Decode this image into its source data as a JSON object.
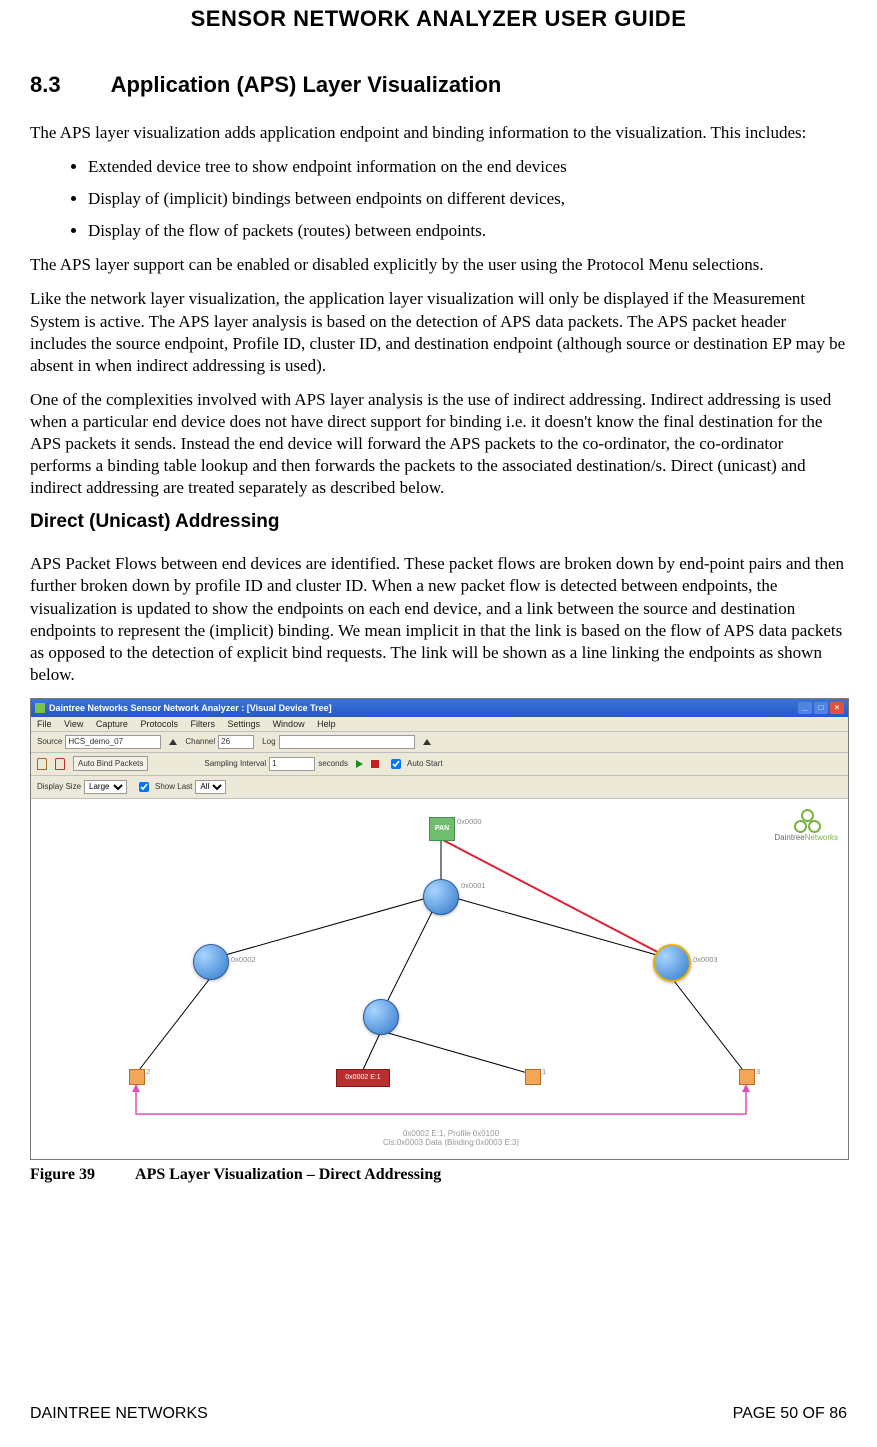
{
  "header": {
    "title": "SENSOR NETWORK ANALYZER USER GUIDE"
  },
  "section": {
    "number": "8.3",
    "title": "Application (APS) Layer Visualization"
  },
  "intro_paragraph": "The APS layer visualization adds application endpoint and binding information to the visualization. This includes:",
  "bullets": {
    "b1": "Extended device tree to show endpoint information on the end devices",
    "b2": "Display of (implicit) bindings between endpoints on different devices,",
    "b3": "Display of the flow of packets (routes) between endpoints."
  },
  "para2": "The APS layer support can be enabled or disabled explicitly by the user using the Protocol Menu selections.",
  "para3": "Like the network layer visualization, the application layer visualization will only be displayed if the Measurement System is active. The APS layer analysis is based on the detection of APS data packets. The APS packet header includes the source endpoint, Profile ID, cluster ID, and destination endpoint (although source or destination EP may be absent in when indirect addressing is used).",
  "para4": "One of the complexities involved with APS layer analysis is the use of indirect addressing. Indirect addressing is used when a particular end device does not have direct support for binding i.e. it doesn't know the final destination for the APS packets it sends. Instead the end device will forward the APS packets to the co-ordinator, the co-ordinator performs a binding table lookup and then forwards the packets to the associated destination/s. Direct (unicast) and indirect addressing are treated separately as described below.",
  "subsection": {
    "title": "Direct (Unicast) Addressing"
  },
  "para5": "APS Packet Flows between end devices are identified. These packet flows are broken down by end-point pairs and then further broken down by profile ID and cluster ID. When a new packet flow is detected between endpoints, the visualization is updated to show the endpoints on each end device, and a link between the source and destination endpoints to represent the (implicit) binding. We mean implicit in that the link is based on the flow of APS data packets as opposed to the detection of explicit bind requests. The link will be shown as a line linking the endpoints as shown below.",
  "app": {
    "titlebar": "Daintree Networks Sensor Network Analyzer : [Visual Device Tree]",
    "menu": {
      "file": "File",
      "view": "View",
      "capture": "Capture",
      "protocols": "Protocols",
      "filters": "Filters",
      "settings": "Settings",
      "window": "Window",
      "help": "Help"
    },
    "toolbar": {
      "source_label": "Source",
      "source_value": "HCS_demo_07",
      "channel_label": "Channel",
      "channel_value": "26",
      "log_label": "Log",
      "log_value": "",
      "auto_bind_label": "Auto Bind Packets",
      "sampling_label": "Sampling Interval",
      "sampling_value": "1",
      "seconds_label": "seconds",
      "auto_start_label": "Auto Start",
      "display_size_label": "Display Size",
      "display_size_value": "Large",
      "show_last_label": "Show Last",
      "show_last_value": "All"
    },
    "nodes": {
      "pan_label": "PAN",
      "pan_addr": "0x0000",
      "router1_addr": "0x0001",
      "router2_addr": "0x0002",
      "router3_addr": "0x0003",
      "end1_label": "1",
      "end2_label": "2",
      "end3_label": "3",
      "redblock_label": "0x0002 E:1",
      "footer_line1": "0x0002 E:1, Profile 0x0100",
      "footer_line2": "Cls:0x0003 Data (Binding:0x0003 E:3)"
    },
    "brand": {
      "line1": "Daintree",
      "line2": "Networks"
    }
  },
  "figure": {
    "number": "Figure 39",
    "caption": "APS Layer Visualization – Direct Addressing"
  },
  "footer": {
    "left": "DAINTREE NETWORKS",
    "right": "PAGE 50 OF 86"
  }
}
